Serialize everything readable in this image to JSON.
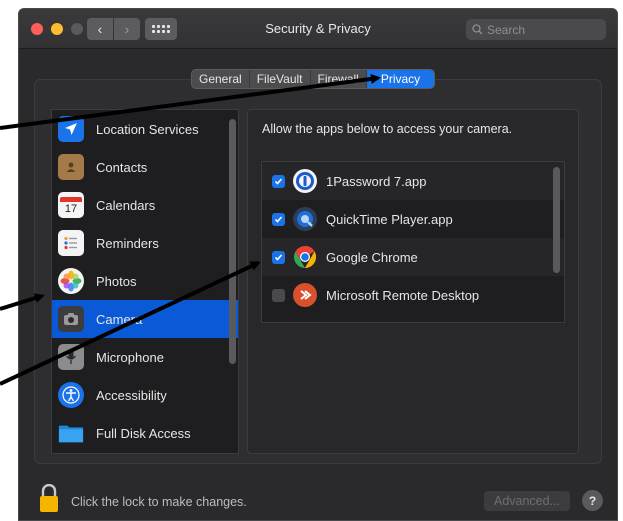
{
  "window": {
    "title": "Security & Privacy"
  },
  "search": {
    "placeholder": "Search"
  },
  "tabs": [
    {
      "label": "General",
      "active": false
    },
    {
      "label": "FileVault",
      "active": false
    },
    {
      "label": "Firewall",
      "active": false
    },
    {
      "label": "Privacy",
      "active": true
    }
  ],
  "sidebar": {
    "items": [
      {
        "label": "Location Services",
        "icon": "location-arrow-icon"
      },
      {
        "label": "Contacts",
        "icon": "contacts-book-icon"
      },
      {
        "label": "Calendars",
        "icon": "calendar-icon",
        "icon_text": "17"
      },
      {
        "label": "Reminders",
        "icon": "reminders-list-icon"
      },
      {
        "label": "Photos",
        "icon": "photos-flower-icon"
      },
      {
        "label": "Camera",
        "icon": "camera-icon",
        "selected": true
      },
      {
        "label": "Microphone",
        "icon": "microphone-icon"
      },
      {
        "label": "Accessibility",
        "icon": "accessibility-icon"
      },
      {
        "label": "Full Disk Access",
        "icon": "folder-icon"
      }
    ]
  },
  "main": {
    "prompt": "Allow the apps below to access your camera.",
    "apps": [
      {
        "name": "1Password 7.app",
        "checked": true,
        "icon": "1password-icon"
      },
      {
        "name": "QuickTime Player.app",
        "checked": true,
        "icon": "quicktime-icon"
      },
      {
        "name": "Google Chrome",
        "checked": true,
        "icon": "chrome-icon"
      },
      {
        "name": "Microsoft Remote Desktop",
        "checked": false,
        "icon": "remote-desktop-icon"
      }
    ]
  },
  "footer": {
    "lock_text": "Click the lock to make changes.",
    "advanced_label": "Advanced...",
    "help_label": "?"
  },
  "colors": {
    "accent": "#1a73e8",
    "selected_row": "#0a5ad8",
    "window_bg": "#2a2a2c"
  }
}
